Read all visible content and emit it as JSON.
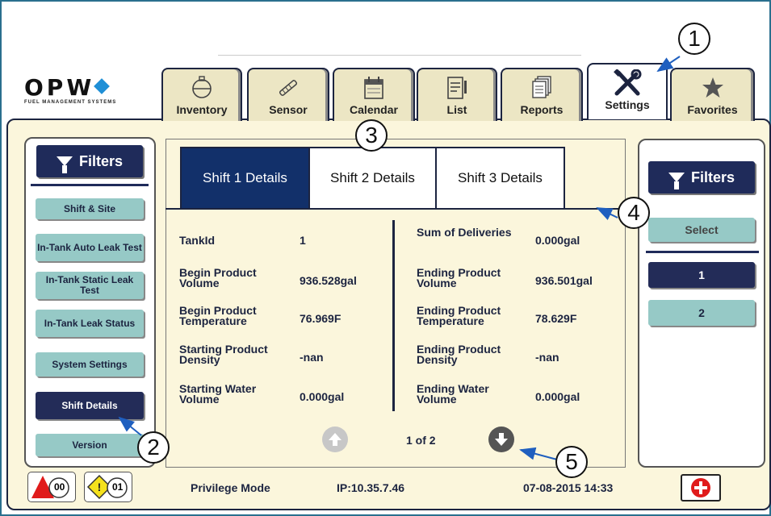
{
  "logo": {
    "brand": "OPW",
    "tagline": "FUEL MANAGEMENT SYSTEMS"
  },
  "tabs": [
    {
      "label": "Inventory",
      "icon": "gauge-icon"
    },
    {
      "label": "Sensor",
      "icon": "probe-icon"
    },
    {
      "label": "Calendar",
      "icon": "calendar-icon"
    },
    {
      "label": "List",
      "icon": "list-icon"
    },
    {
      "label": "Reports",
      "icon": "reports-icon"
    },
    {
      "label": "Settings",
      "icon": "tools-icon",
      "active": true
    },
    {
      "label": "Favorites",
      "icon": "star-icon"
    }
  ],
  "left_panel": {
    "filters_label": "Filters",
    "items": [
      {
        "label": "Shift & Site"
      },
      {
        "label": "In-Tank Auto Leak Test"
      },
      {
        "label": "In-Tank Static Leak Test"
      },
      {
        "label": "In-Tank Leak Status"
      },
      {
        "label": "System Settings"
      },
      {
        "label": "Shift Details",
        "active": true
      },
      {
        "label": "Version"
      }
    ]
  },
  "shift_tabs": [
    {
      "label": "Shift 1 Details",
      "active": true
    },
    {
      "label": "Shift 2 Details"
    },
    {
      "label": "Shift 3 Details"
    }
  ],
  "details_left": [
    {
      "label": "TankId",
      "value": "1"
    },
    {
      "label": "Begin Product Volume",
      "value": "936.528gal"
    },
    {
      "label": "Begin Product Temperature",
      "value": "76.969F"
    },
    {
      "label": "Starting Product Density",
      "value": "-nan"
    },
    {
      "label": "Starting Water Volume",
      "value": "0.000gal"
    }
  ],
  "details_right": [
    {
      "label": "Sum of Deliveries",
      "value": "0.000gal"
    },
    {
      "label": "Ending Product Volume",
      "value": "936.501gal"
    },
    {
      "label": "Ending Product Temperature",
      "value": "78.629F"
    },
    {
      "label": "Ending Product Density",
      "value": "-nan"
    },
    {
      "label": "Ending Water Volume",
      "value": "0.000gal"
    }
  ],
  "pager": {
    "text": "1 of 2"
  },
  "right_panel": {
    "filters_label": "Filters",
    "select_label": "Select",
    "items": [
      {
        "label": "1",
        "active": true
      },
      {
        "label": "2"
      }
    ]
  },
  "status_bar": {
    "alarm_count": "00",
    "warning_count": "01",
    "mode": "Privilege Mode",
    "ip": "IP:10.35.7.46",
    "datetime": "07-08-2015 14:33"
  },
  "callouts": [
    "1",
    "2",
    "3",
    "4",
    "5"
  ],
  "colors": {
    "navy": "#1f2b5a",
    "teal": "#96c9c6",
    "panel": "#fbf6dc",
    "active_tab": "#12306a",
    "alarm_red": "#e01b1b"
  }
}
